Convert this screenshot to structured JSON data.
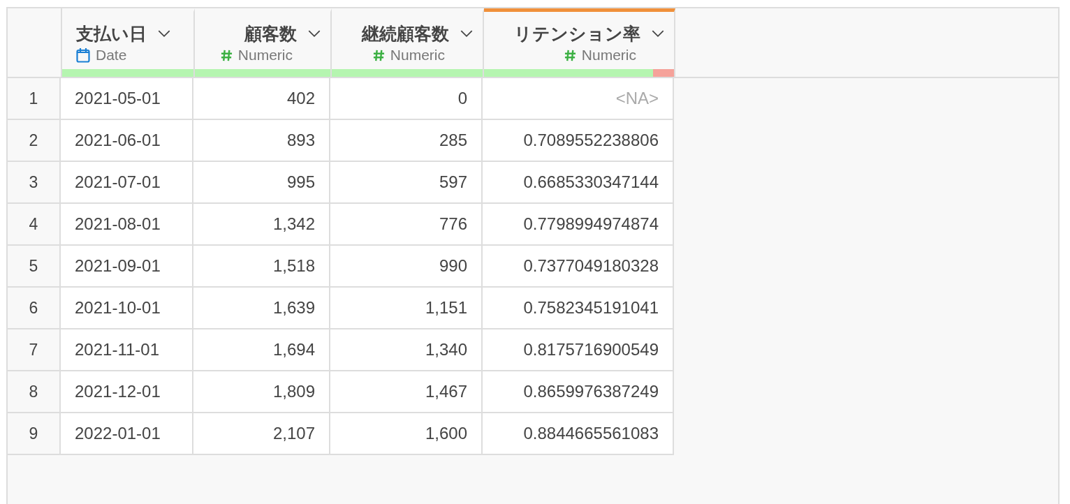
{
  "table": {
    "columns": [
      {
        "name": "支払い日",
        "type": "Date",
        "kind": "date",
        "selected": false,
        "level": 1
      },
      {
        "name": "顧客数",
        "type": "Numeric",
        "kind": "numeric",
        "selected": false,
        "level": 1
      },
      {
        "name": "継続顧客数",
        "type": "Numeric",
        "kind": "numeric",
        "selected": false,
        "level": 1
      },
      {
        "name": "リテンション率",
        "type": "Numeric",
        "kind": "numeric",
        "selected": true,
        "level": 0.89
      }
    ],
    "rows": [
      {
        "index": "1",
        "cells": [
          {
            "text": "2021-05-01",
            "missing": false
          },
          {
            "text": "402",
            "missing": false
          },
          {
            "text": "0",
            "missing": false
          },
          {
            "text": "<NA>",
            "missing": true
          }
        ]
      },
      {
        "index": "2",
        "cells": [
          {
            "text": "2021-06-01",
            "missing": false
          },
          {
            "text": "893",
            "missing": false
          },
          {
            "text": "285",
            "missing": false
          },
          {
            "text": "0.7089552238806",
            "missing": false
          }
        ]
      },
      {
        "index": "3",
        "cells": [
          {
            "text": "2021-07-01",
            "missing": false
          },
          {
            "text": "995",
            "missing": false
          },
          {
            "text": "597",
            "missing": false
          },
          {
            "text": "0.6685330347144",
            "missing": false
          }
        ]
      },
      {
        "index": "4",
        "cells": [
          {
            "text": "2021-08-01",
            "missing": false
          },
          {
            "text": "1,342",
            "missing": false
          },
          {
            "text": "776",
            "missing": false
          },
          {
            "text": "0.7798994974874",
            "missing": false
          }
        ]
      },
      {
        "index": "5",
        "cells": [
          {
            "text": "2021-09-01",
            "missing": false
          },
          {
            "text": "1,518",
            "missing": false
          },
          {
            "text": "990",
            "missing": false
          },
          {
            "text": "0.7377049180328",
            "missing": false
          }
        ]
      },
      {
        "index": "6",
        "cells": [
          {
            "text": "2021-10-01",
            "missing": false
          },
          {
            "text": "1,639",
            "missing": false
          },
          {
            "text": "1,151",
            "missing": false
          },
          {
            "text": "0.7582345191041",
            "missing": false
          }
        ]
      },
      {
        "index": "7",
        "cells": [
          {
            "text": "2021-11-01",
            "missing": false
          },
          {
            "text": "1,694",
            "missing": false
          },
          {
            "text": "1,340",
            "missing": false
          },
          {
            "text": "0.8175716900549",
            "missing": false
          }
        ]
      },
      {
        "index": "8",
        "cells": [
          {
            "text": "2021-12-01",
            "missing": false
          },
          {
            "text": "1,809",
            "missing": false
          },
          {
            "text": "1,467",
            "missing": false
          },
          {
            "text": "0.8659976387249",
            "missing": false
          }
        ]
      },
      {
        "index": "9",
        "cells": [
          {
            "text": "2022-01-01",
            "missing": false
          },
          {
            "text": "2,107",
            "missing": false
          },
          {
            "text": "1,600",
            "missing": false
          },
          {
            "text": "0.8844665561083",
            "missing": false
          }
        ]
      }
    ]
  }
}
